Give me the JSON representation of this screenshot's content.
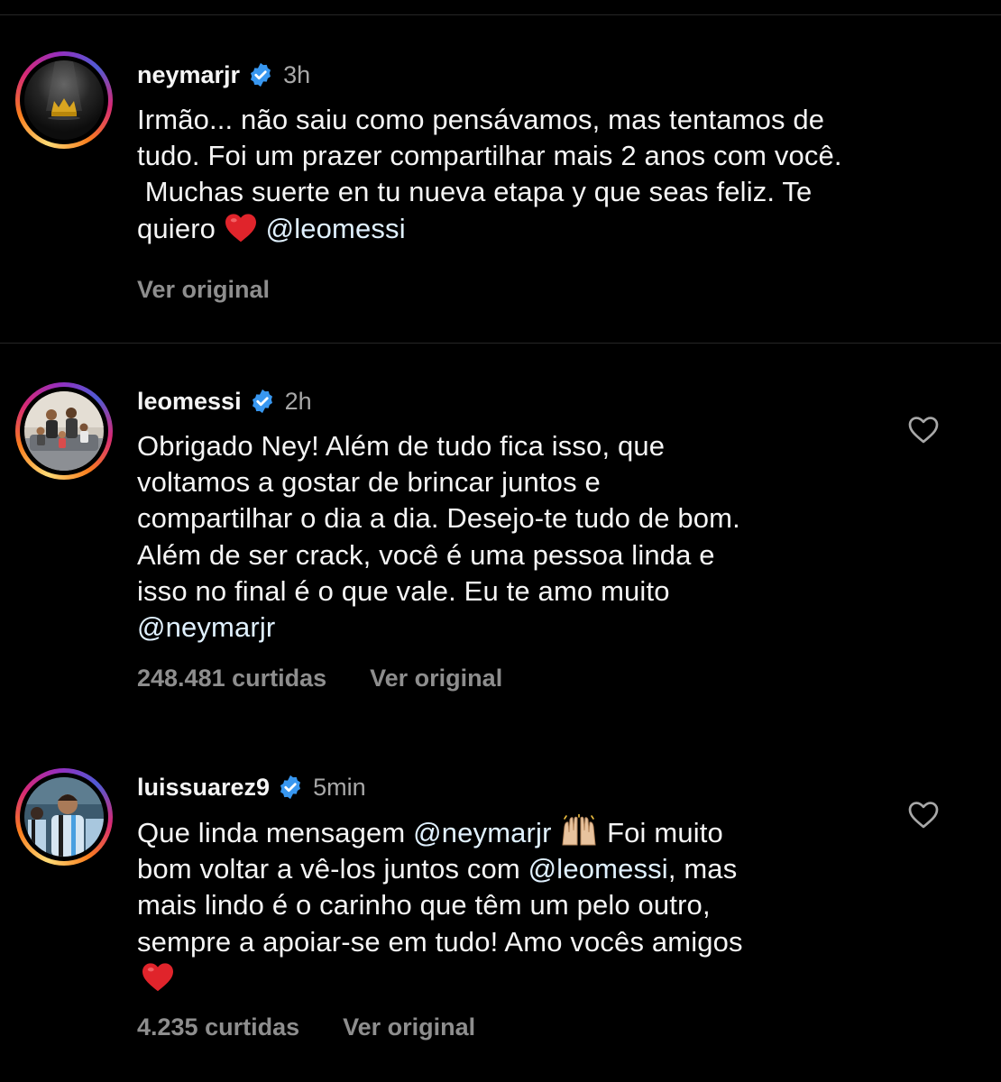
{
  "colors": {
    "background": "#000000",
    "text": "#f5f5f5",
    "muted": "#8e8e8e",
    "timestamp": "#a8a8a8",
    "verified": "#3897f0",
    "divider": "#262626"
  },
  "comments": [
    {
      "username": "neymarjr",
      "verified": true,
      "time": "3h",
      "text_lines": [
        "Irmão... não saiu como pensávamos, mas tentamos de",
        "tudo. Foi um prazer compartilhar mais 2 anos com você.",
        " Muchas suerte en tu nueva etapa y que seas feliz. Te",
        "quiero",
        "@leomessi"
      ],
      "emoji": "red-heart",
      "translate_label": "Ver original",
      "avatar_icon": "crown-icon"
    },
    {
      "username": "leomessi",
      "verified": true,
      "time": "2h",
      "text_lines": [
        "Obrigado Ney! Além de tudo fica isso, que",
        "voltamos a gostar de brincar juntos e",
        "compartilhar o dia a dia. Desejo-te tudo de bom.",
        "Além de ser crack, você é uma pessoa linda e",
        "isso no final é o que vale. Eu te amo muito",
        "@neymarjr"
      ],
      "likes": "248.481 curtidas",
      "translate_label": "Ver original",
      "like_icon": "heart-outline-icon"
    },
    {
      "username": "luissuarez9",
      "verified": true,
      "time": "5min",
      "text_lines": [
        "Que linda mensagem",
        "@neymarjr",
        "Foi muito",
        "bom voltar a vê-los juntos com",
        "@leomessi",
        ", mas",
        "mais lindo é o carinho que têm um pelo outro,",
        "sempre a apoiar-se em tudo! Amo vocês amigos"
      ],
      "emojis": [
        "raising-hands",
        "red-heart"
      ],
      "likes": "4.235 curtidas",
      "translate_label": "Ver original",
      "like_icon": "heart-outline-icon"
    }
  ]
}
